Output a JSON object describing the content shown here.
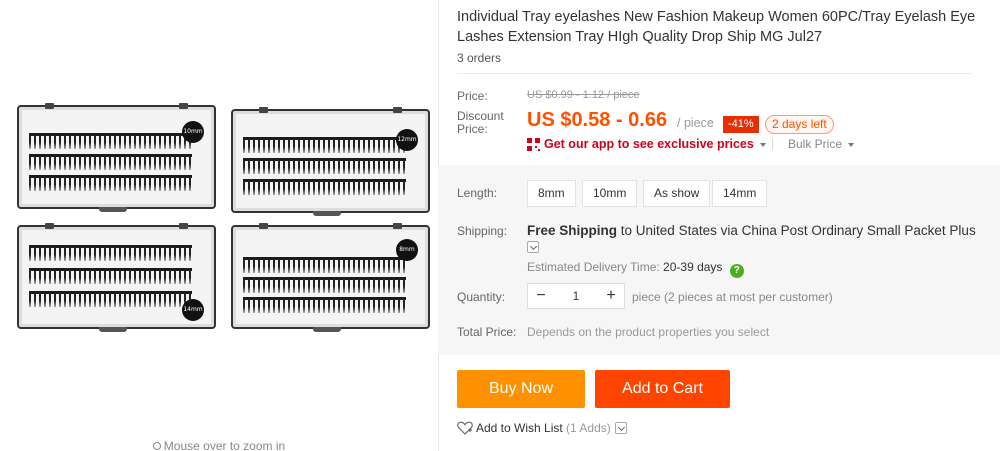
{
  "product": {
    "title": "Individual Tray eyelashes New Fashion Makeup Women 60PC/Tray Eyelash Eye Lashes Extension Tray HIgh Quality Drop Ship MG Jul27",
    "orders": "3 orders"
  },
  "gallery": {
    "zoom_hint": "Mouse over to zoom in",
    "tray_badges": [
      "10mm",
      "12mm",
      "14mm",
      "8mm"
    ]
  },
  "price": {
    "label": "Price:",
    "original": "US $0.99 - 1.12 / piece",
    "discount_label": "Discount Price:",
    "discount_value": "US $0.58 - 0.66",
    "unit": "/ piece",
    "discount_percent": "-41%",
    "time_left": "2 days left"
  },
  "app_promo": {
    "text": "Get our app to see exclusive prices",
    "bulk_price": "Bulk Price"
  },
  "length": {
    "label": "Length:",
    "options": [
      "8mm",
      "10mm",
      "As show",
      "14mm"
    ]
  },
  "shipping": {
    "label": "Shipping:",
    "free": "Free Shipping",
    "to_text": "to United States via China Post Ordinary Small Packet Plus",
    "delivery_label": "Estimated Delivery Time:",
    "delivery_days": "20-39 days",
    "help_icon": "?"
  },
  "quantity": {
    "label": "Quantity:",
    "minus": "−",
    "value": "1",
    "plus": "+",
    "note": "piece (2 pieces at most per customer)"
  },
  "total": {
    "label": "Total Price:",
    "value": "Depends on the product properties you select"
  },
  "actions": {
    "buy_now": "Buy Now",
    "add_to_cart": "Add to Cart",
    "wish_list": "Add to Wish List",
    "wish_count": "(1 Adds)"
  },
  "colors": {
    "accent": "#ff5000",
    "buy_now": "#ff9000",
    "add_to_cart": "#ff4400",
    "discount_badge": "#e62e04",
    "app_link": "#d0021b",
    "help_icon": "#4caf20"
  }
}
